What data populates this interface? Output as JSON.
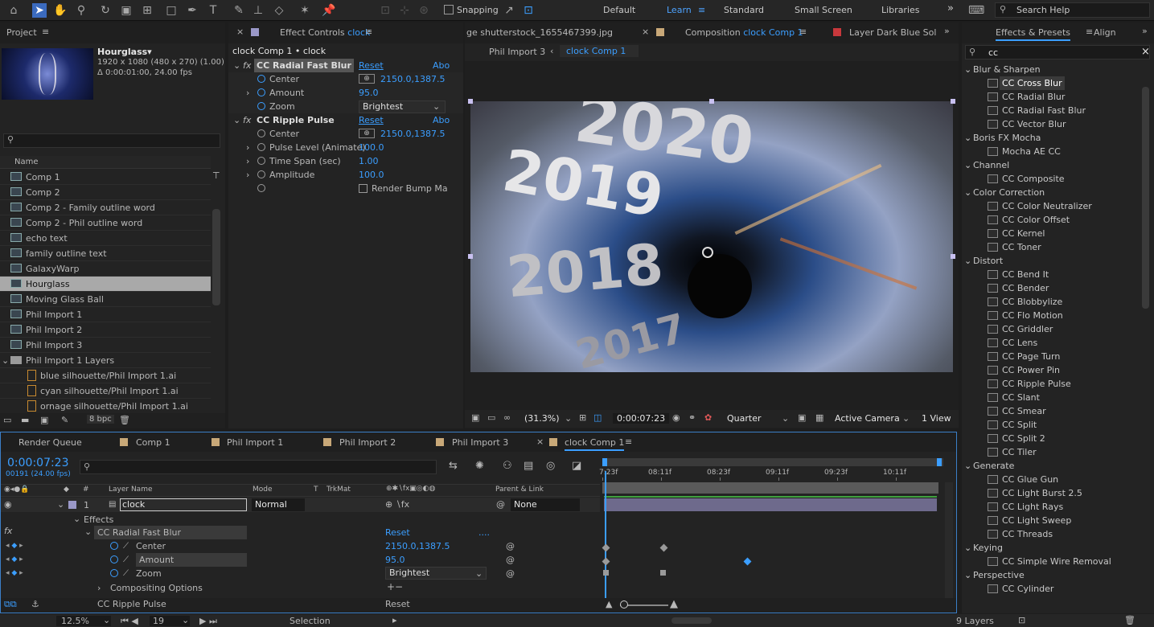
{
  "toolbar": {
    "snapping_label": "Snapping",
    "workspaces": [
      "Default",
      "Learn",
      "Standard",
      "Small Screen",
      "Libraries"
    ],
    "active_workspace": "Learn",
    "search_help_placeholder": "Search Help"
  },
  "project": {
    "tab_label": "Project",
    "selected_name": "Hourglass▾",
    "selected_info1": "1920 x 1080  (480 x 270) (1.00)",
    "selected_info2": "Δ 0:00:01:00, 24.00 fps",
    "search_placeholder": "",
    "column_name": "Name",
    "items": [
      {
        "label": "Comp 1",
        "type": "comp"
      },
      {
        "label": "Comp 2",
        "type": "comp"
      },
      {
        "label": "Comp 2 - Family outline word",
        "type": "comp"
      },
      {
        "label": "Comp 2 - Phil outline word",
        "type": "comp"
      },
      {
        "label": "echo text",
        "type": "comp"
      },
      {
        "label": "family outline text",
        "type": "comp"
      },
      {
        "label": "GalaxyWarp",
        "type": "comp"
      },
      {
        "label": "Hourglass",
        "type": "comp"
      },
      {
        "label": "Moving Glass Ball",
        "type": "comp"
      },
      {
        "label": "Phil Import 1",
        "type": "comp"
      },
      {
        "label": "Phil Import 2",
        "type": "comp"
      },
      {
        "label": "Phil Import 3",
        "type": "comp"
      },
      {
        "label": "Phil Import 1 Layers",
        "type": "folder"
      },
      {
        "label": "blue silhouette/Phil Import 1.ai",
        "type": "ai"
      },
      {
        "label": "cyan silhouette/Phil Import 1.ai",
        "type": "ai"
      },
      {
        "label": "ornage silhouette/Phil Import 1.ai",
        "type": "ai"
      }
    ],
    "bpc_label": "8 bpc"
  },
  "effect_controls": {
    "tab_label": "Effect Controls",
    "tab_target": "clock",
    "header": "clock Comp 1 • clock",
    "effects": [
      {
        "name": "CC Radial Fast Blur",
        "reset": "Reset",
        "about": "Abo",
        "props": [
          {
            "name": "Center",
            "value": "2150.0,1387.5"
          },
          {
            "name": "Amount",
            "value": "95.0"
          },
          {
            "name": "Zoom",
            "value": "Brightest"
          }
        ]
      },
      {
        "name": "CC Ripple Pulse",
        "reset": "Reset",
        "about": "Abo",
        "props": [
          {
            "name": "Center",
            "value": "2150.0,1387.5"
          },
          {
            "name": "Pulse Level (Animate)",
            "value": "100.0"
          },
          {
            "name": "Time Span (sec)",
            "value": "1.00"
          },
          {
            "name": "Amplitude",
            "value": "100.0"
          },
          {
            "name": "",
            "value": "Render Bump Ma"
          }
        ]
      }
    ]
  },
  "composition": {
    "tabs": [
      "ge shutterstock_1655467399.jpg",
      "Composition",
      "Layer Dark Blue Sol"
    ],
    "comp_tab_target": "clock Comp 1",
    "breadcrumb": [
      "Phil Import 3",
      "clock Comp 1"
    ],
    "numbers_in_image": [
      "2020",
      "2019",
      "2018",
      "2017"
    ],
    "zoom": "(31.3%)",
    "timecode": "0:00:07:23",
    "resolution": "Quarter",
    "camera": "Active Camera",
    "views": "1 View"
  },
  "effects_presets": {
    "tab_label": "Effects & Presets",
    "align_label": "Align",
    "search_value": "cc",
    "groups": [
      {
        "name": "Blur & Sharpen",
        "items": [
          "CC Cross Blur",
          "CC Radial Blur",
          "CC Radial Fast Blur",
          "CC Vector Blur"
        ]
      },
      {
        "name": "Boris FX Mocha",
        "items": [
          "Mocha AE CC"
        ]
      },
      {
        "name": "Channel",
        "items": [
          "CC Composite"
        ]
      },
      {
        "name": "Color Correction",
        "items": [
          "CC Color Neutralizer",
          "CC Color Offset",
          "CC Kernel",
          "CC Toner"
        ]
      },
      {
        "name": "Distort",
        "items": [
          "CC Bend It",
          "CC Bender",
          "CC Blobbylize",
          "CC Flo Motion",
          "CC Griddler",
          "CC Lens",
          "CC Page Turn",
          "CC Power Pin",
          "CC Ripple Pulse",
          "CC Slant",
          "CC Smear",
          "CC Split",
          "CC Split 2",
          "CC Tiler"
        ]
      },
      {
        "name": "Generate",
        "items": [
          "CC Glue Gun",
          "CC Light Burst 2.5",
          "CC Light Rays",
          "CC Light Sweep",
          "CC Threads"
        ]
      },
      {
        "name": "Keying",
        "items": [
          "CC Simple Wire Removal"
        ]
      },
      {
        "name": "Perspective",
        "items": [
          "CC Cylinder"
        ]
      }
    ],
    "selected_item": "CC Cross Blur"
  },
  "timeline": {
    "tabs": [
      "Render Queue",
      "Comp 1",
      "Phil Import 1",
      "Phil Import 2",
      "Phil Import 3",
      "clock Comp 1"
    ],
    "active_tab": "clock Comp 1",
    "timecode": "0:00:07:23",
    "frame_info": "00191 (24.00 fps)",
    "col_layer_name": "Layer Name",
    "col_mode": "Mode",
    "col_t": "T",
    "col_trkmat": "TrkMat",
    "col_parent": "Parent & Link",
    "col_num": "#",
    "ruler": [
      "7:23f",
      "08:11f",
      "08:23f",
      "09:11f",
      "09:23f",
      "10:11f"
    ],
    "layer": {
      "num": "1",
      "name": "clock",
      "mode": "Normal",
      "parent": "None"
    },
    "effects_label": "Effects",
    "effect_name": "CC Radial Fast Blur",
    "effect_reset": "Reset",
    "effect_dots": "....",
    "props": [
      {
        "name": "Center",
        "value": "2150.0,1387.5"
      },
      {
        "name": "Amount",
        "value": "95.0"
      },
      {
        "name": "Zoom",
        "value": "Brightest"
      }
    ],
    "compositing": "Compositing Options",
    "next_effect": "CC Ripple Pulse",
    "next_reset": "Reset"
  },
  "statusbar": {
    "zoom": "12.5%",
    "frame": "19",
    "tool": "Selection",
    "layers": "9 Layers"
  }
}
